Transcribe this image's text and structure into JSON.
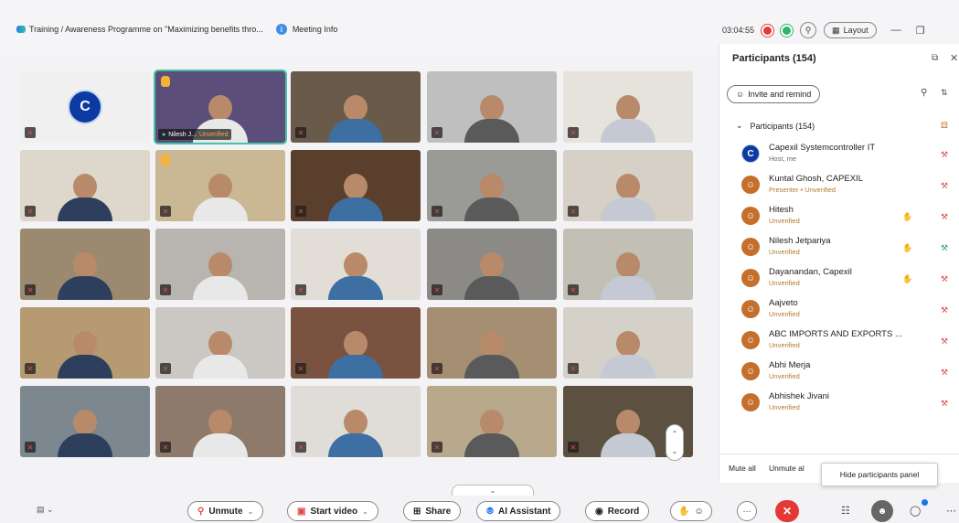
{
  "header": {
    "meeting_title": "Training / Awareness Programme on \"Maximizing benefits thro...",
    "meeting_info": "Meeting Info",
    "timer": "03:04:55",
    "layout_label": "Layout"
  },
  "tiles": [
    {
      "label": "",
      "logo": "C",
      "bg": "#f0f0f0"
    },
    {
      "label": "Nilesh J...",
      "unverified": "Unverified",
      "hand": true,
      "active": true,
      "bg": "#5b4e7a"
    },
    {
      "label": "",
      "bg": "#6a5a4a"
    },
    {
      "label": "",
      "bg": "#bfbfbf"
    },
    {
      "label": "",
      "bg": "#e6e2dc"
    },
    {
      "label": "",
      "bg": "#ded7cc"
    },
    {
      "label": "",
      "hand": true,
      "bg": "#c9b893"
    },
    {
      "label": "",
      "bg": "#5a3f2c"
    },
    {
      "label": "",
      "bg": "#9a9a96"
    },
    {
      "label": "",
      "bg": "#d6d0c6"
    },
    {
      "label": "",
      "bg": "#9c8a70"
    },
    {
      "label": "",
      "bg": "#b8b4b0"
    },
    {
      "label": "",
      "bg": "#e2ddd6"
    },
    {
      "label": "",
      "bg": "#8b8a86"
    },
    {
      "label": "",
      "bg": "#c2bfb5"
    },
    {
      "label": "",
      "bg": "#b59a72"
    },
    {
      "label": "",
      "bg": "#cbc7c2"
    },
    {
      "label": "",
      "bg": "#7a5340"
    },
    {
      "label": "",
      "bg": "#a68e72"
    },
    {
      "label": "",
      "bg": "#d5d1c8"
    },
    {
      "label": "",
      "bg": "#7c8790"
    },
    {
      "label": "",
      "bg": "#8d7a6a"
    },
    {
      "label": "",
      "bg": "#e0ddd8"
    },
    {
      "label": "",
      "bg": "#b8a88c"
    },
    {
      "label": "",
      "bg": "#5c5040"
    }
  ],
  "panel": {
    "title": "Participants (154)",
    "invite_label": "Invite and remind",
    "group_label": "Participants (154)",
    "participants": [
      {
        "name": "Capexil Systemcontroller IT",
        "sub": "Host, me",
        "host": true,
        "hand": false,
        "mic_on": false
      },
      {
        "name": "Kuntal Ghosh, CAPEXIL",
        "sub": "Presenter • Unverified",
        "host": false,
        "hand": false,
        "mic_on": false
      },
      {
        "name": "Hitesh",
        "sub": "Unverified",
        "host": false,
        "hand": true,
        "mic_on": false
      },
      {
        "name": "Nilesh Jetpariya",
        "sub": "Unverified",
        "host": false,
        "hand": true,
        "mic_on": true
      },
      {
        "name": "Dayanandan, Capexil",
        "sub": "Unverified",
        "host": false,
        "hand": true,
        "mic_on": false
      },
      {
        "name": "Aajveto",
        "sub": "Unverified",
        "host": false,
        "hand": false,
        "mic_on": false
      },
      {
        "name": "ABC IMPORTS AND EXPORTS ...",
        "sub": "Unverified",
        "host": false,
        "hand": false,
        "mic_on": false
      },
      {
        "name": "Abhi Merja",
        "sub": "Unverified",
        "host": false,
        "hand": false,
        "mic_on": false
      },
      {
        "name": "Abhishek Jivani",
        "sub": "Unverified",
        "host": false,
        "hand": false,
        "mic_on": false
      }
    ],
    "mute_all": "Mute all",
    "unmute_all": "Unmute al",
    "tooltip": "Hide participants panel"
  },
  "toolbar": {
    "unmute": "Unmute",
    "start_video": "Start video",
    "share": "Share",
    "ai_assistant": "AI Assistant",
    "record": "Record"
  }
}
